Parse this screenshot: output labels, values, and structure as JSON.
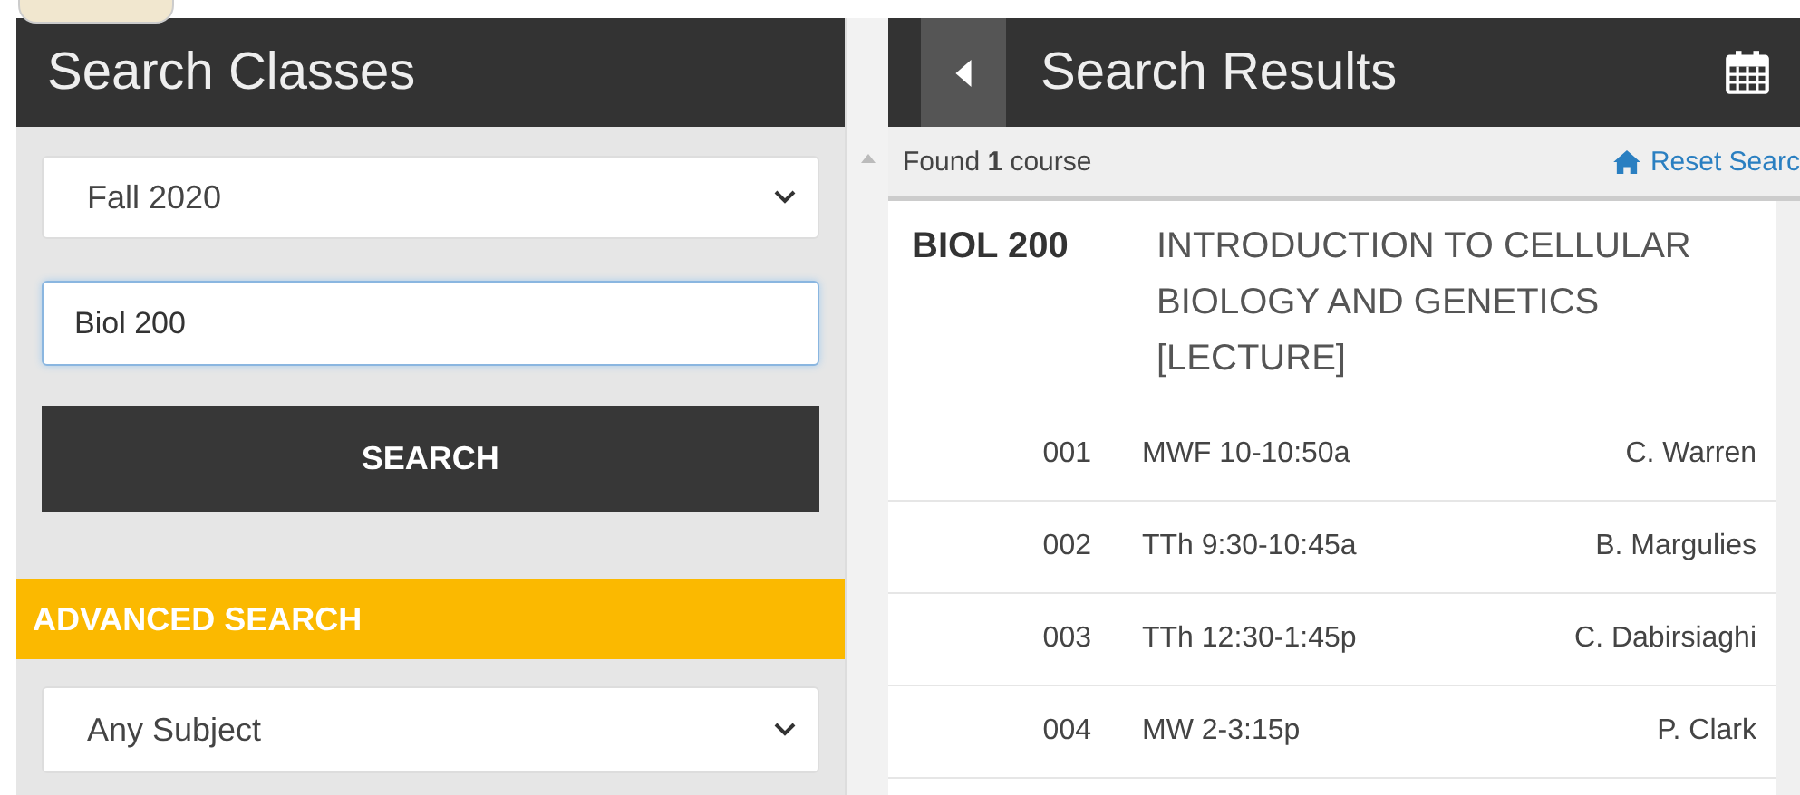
{
  "search_panel": {
    "title": "Search Classes",
    "term_select": {
      "value": "Fall 2020"
    },
    "query_field": {
      "value": "Biol 200"
    },
    "search_button": "SEARCH",
    "advanced_search": {
      "label": "ADVANCED SEARCH",
      "subject_select": {
        "value": "Any Subject"
      }
    }
  },
  "results_panel": {
    "title": "Search Results",
    "found_text": "Found **1** course",
    "reset_link": "Reset Searc",
    "course": {
      "code": "BIOL 200",
      "title": "INTRODUCTION TO CELLULAR BIOLOGY AND GENETICS [LECTURE]",
      "sections": [
        {
          "number": "001",
          "schedule": "MWF 10-10:50a",
          "instructor": "C. Warren"
        },
        {
          "number": "002",
          "schedule": "TTh 9:30-10:45a",
          "instructor": "B. Margulies"
        },
        {
          "number": "003",
          "schedule": "TTh 12:30-1:45p",
          "instructor": "C. Dabirsiaghi"
        },
        {
          "number": "004",
          "schedule": "MW 2-3:15p",
          "instructor": "P. Clark"
        }
      ]
    }
  }
}
